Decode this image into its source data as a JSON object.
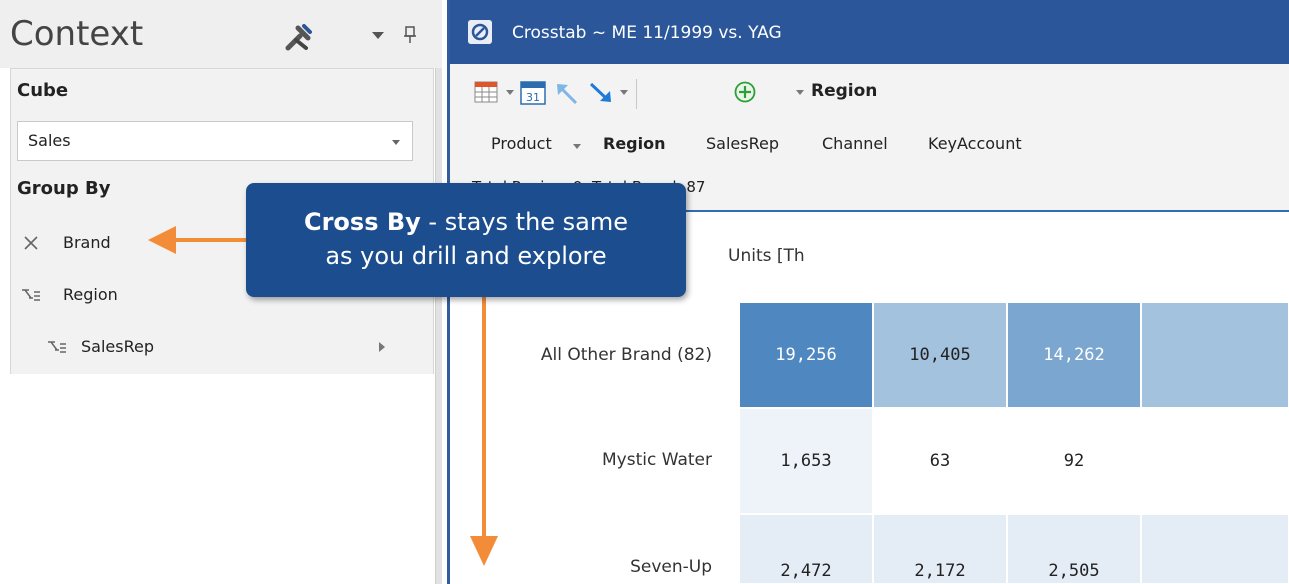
{
  "context_panel": {
    "title": "Context",
    "cube_label": "Cube",
    "cube_value": "Sales",
    "group_by_label": "Group By",
    "group_items": [
      {
        "label": "Brand",
        "icon": "close-icon"
      },
      {
        "label": "Region",
        "icon": "drill-icon"
      },
      {
        "label": "SalesRep",
        "icon": "drill-icon"
      }
    ]
  },
  "window": {
    "title": "Crosstab ~ ME 11/1999  vs. YAG",
    "active_dimension": "Region",
    "dimension_tabs": [
      "Product",
      "Region",
      "SalesRep",
      "Channel",
      "KeyAccount"
    ],
    "status": "Total Region: 9, Total Brand: 87",
    "units_label": "Units [Th"
  },
  "crosstab": {
    "rows": [
      {
        "label": "All Other Brand (82)",
        "values": [
          "19,256",
          "10,405",
          "14,262",
          ""
        ]
      },
      {
        "label": "Mystic Water",
        "values": [
          "1,653",
          "63",
          "92",
          ""
        ]
      },
      {
        "label": "Seven-Up",
        "values": [
          "2,472",
          "2,172",
          "2,505",
          ""
        ]
      }
    ]
  },
  "callout": {
    "bold_text": "Cross By",
    "line1_rest": " - stays the same",
    "line2": "as you drill and explore"
  },
  "colors": {
    "titlebar": "#2b579a",
    "callout": "#1c4e8f",
    "arrow": "#f28c38",
    "cell_dark": "#4f88c1",
    "cell_medium": "#a3c2de",
    "cell_light": "#eef3f9"
  }
}
